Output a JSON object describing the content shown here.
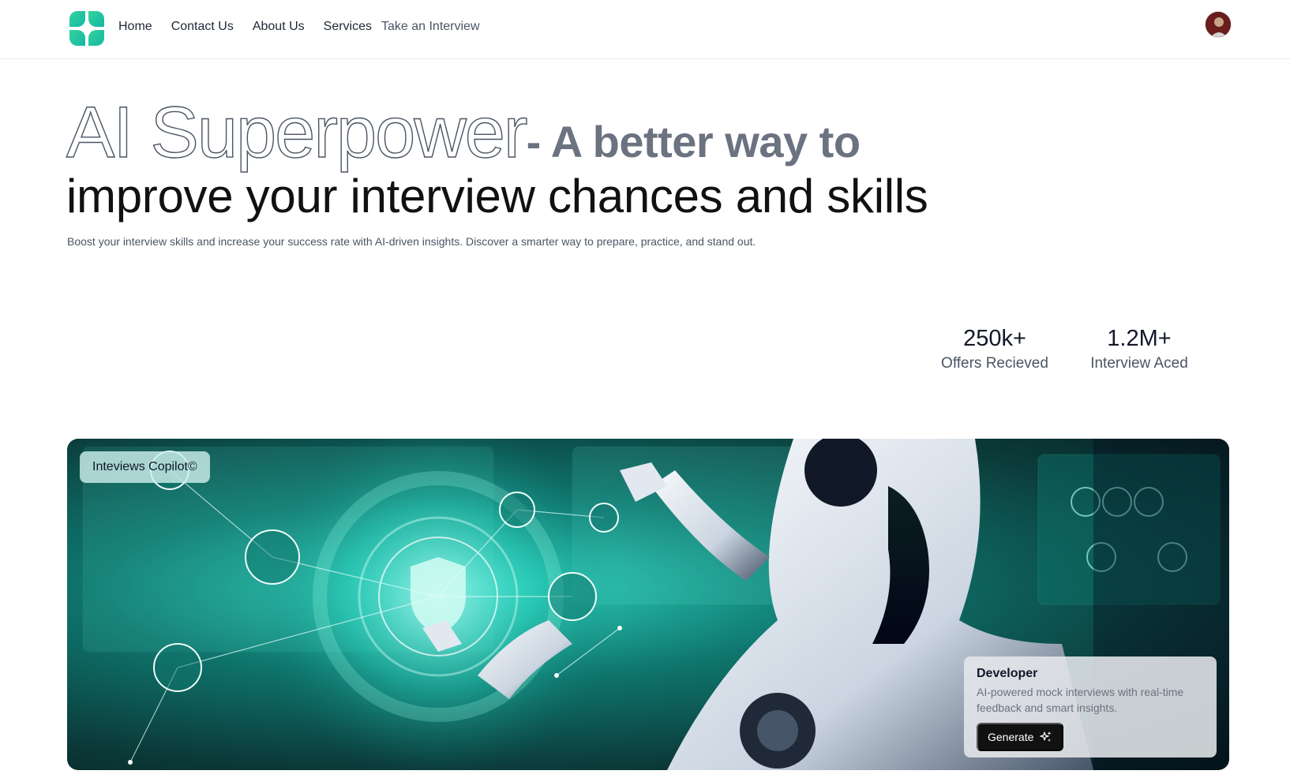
{
  "nav": {
    "links": [
      "Home",
      "Contact Us",
      "About Us",
      "Services"
    ],
    "cta": "Take an Interview",
    "logo_icon": "clover-logo-icon",
    "avatar_icon": "user-avatar"
  },
  "hero": {
    "outline_word": "AI Superpower",
    "gray_phrase": "- A better way to",
    "line2": "improve your interview chances and skills",
    "subtitle": "Boost your interview skills and increase your success rate with AI-driven insights. Discover a smarter way to prepare, practice, and stand out."
  },
  "stats": [
    {
      "value": "250k+",
      "label": "Offers Recieved"
    },
    {
      "value": "1.2M+",
      "label": "Interview Aced"
    }
  ],
  "banner": {
    "badge": "Inteviews Copilot©",
    "card": {
      "title": "Developer",
      "description": "AI-powered mock interviews with real-time feedback and smart insights.",
      "button_label": "Generate",
      "button_icon": "sparkles-icon"
    }
  },
  "colors": {
    "logo": "#2dd4bf",
    "accent_gray": "#6b7280",
    "button_bg": "#111111",
    "banner_teal": "#0f766e"
  }
}
